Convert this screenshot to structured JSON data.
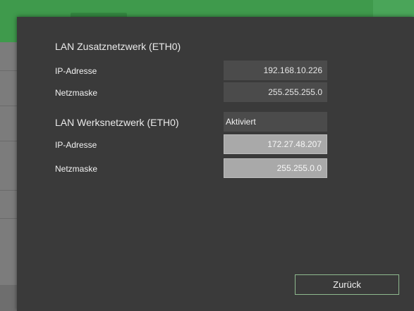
{
  "dialog": {
    "section_additional": {
      "title": "LAN Zusatznetzwerk (ETH0)",
      "ip_label": "IP-Adresse",
      "ip_value": "192.168.10.226",
      "mask_label": "Netzmaske",
      "mask_value": "255.255.255.0"
    },
    "section_plant": {
      "title": "LAN Werksnetzwerk (ETH0)",
      "status": "Aktiviert",
      "ip_label": "IP-Adresse",
      "ip_value": "172.27.48.207",
      "mask_label": "Netzmaske",
      "mask_value": "255.255.0.0"
    },
    "back_label": "Zurück"
  },
  "colors": {
    "header_green": "#3f9a4c",
    "dialog_bg": "#3a3a3a",
    "readonly_field": "#4b4b4b",
    "editable_field": "#a9a9a9",
    "button_border": "#8fb98f"
  }
}
